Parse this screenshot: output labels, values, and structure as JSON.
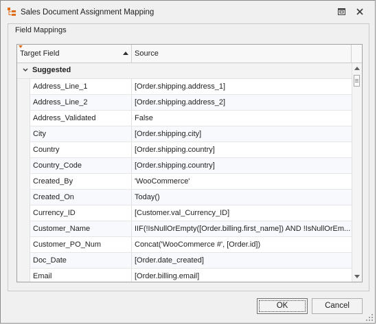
{
  "window": {
    "title": "Sales Document Assignment Mapping"
  },
  "panel": {
    "title": "Field Mappings"
  },
  "grid": {
    "columns": {
      "target": "Target Field",
      "source": "Source"
    },
    "sort": {
      "column": "Target Field",
      "direction": "ascending"
    },
    "group": "Suggested",
    "rows": [
      {
        "target": "Address_Line_1",
        "source": "[Order.shipping.address_1]"
      },
      {
        "target": "Address_Line_2",
        "source": "[Order.shipping.address_2]"
      },
      {
        "target": "Address_Validated",
        "source": "False"
      },
      {
        "target": "City",
        "source": "[Order.shipping.city]"
      },
      {
        "target": "Country",
        "source": "[Order.shipping.country]"
      },
      {
        "target": "Country_Code",
        "source": "[Order.shipping.country]"
      },
      {
        "target": "Created_By",
        "source": "'WooCommerce'"
      },
      {
        "target": "Created_On",
        "source": "Today()"
      },
      {
        "target": "Currency_ID",
        "source": "[Customer.val_Currency_ID]"
      },
      {
        "target": "Customer_Name",
        "source": "IIF(!IsNullOrEmpty([Order.billing.first_name]) AND !IsNullOrEm..."
      },
      {
        "target": "Customer_PO_Num",
        "source": "Concat('WooCommerce #', [Order.id])"
      },
      {
        "target": "Doc_Date",
        "source": "[Order.date_created]"
      },
      {
        "target": "Email",
        "source": "[Order.billing.email]"
      }
    ]
  },
  "buttons": {
    "ok": "OK",
    "cancel": "Cancel"
  },
  "icons": {
    "app": "hierarchy-icon",
    "restore": "restore-window-icon",
    "close": "close-icon",
    "filter": "filter-indicator-icon",
    "sort": "sort-ascending-icon",
    "collapse": "chevron-down-icon"
  },
  "colors": {
    "accent": "#e06c1a",
    "background": "#f0f0f0"
  }
}
